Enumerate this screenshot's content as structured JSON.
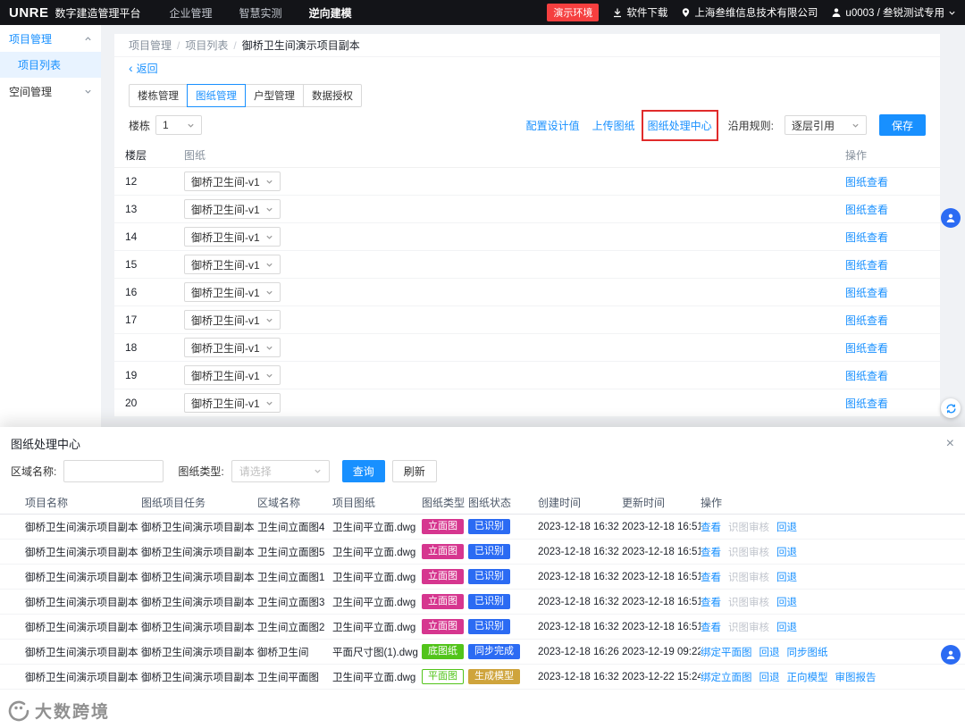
{
  "navbar": {
    "logo": "UNRE",
    "title": "数字建造管理平台",
    "menu": [
      {
        "label": "企业管理",
        "active": false
      },
      {
        "label": "智慧实测",
        "active": false
      },
      {
        "label": "逆向建模",
        "active": true
      }
    ],
    "env_badge": "演示环境",
    "download_label": "软件下载",
    "company": "上海叁维信息技术有限公司",
    "user": "u0003 / 叁锐测试专用"
  },
  "sidebar": {
    "group1": "项目管理",
    "item_selected": "项目列表",
    "group2": "空间管理"
  },
  "page": {
    "breadcrumb": [
      "项目管理",
      "项目列表",
      "御桥卫生间演示项目副本"
    ],
    "back": "返回"
  },
  "tabs": [
    {
      "label": "楼栋管理",
      "active": false
    },
    {
      "label": "图纸管理",
      "active": true
    },
    {
      "label": "户型管理",
      "active": false
    },
    {
      "label": "数据授权",
      "active": false
    }
  ],
  "toolbar": {
    "building_label": "楼栋",
    "building_value": "1",
    "link_config": "配置设计值",
    "link_upload": "上传图纸",
    "link_center": "图纸处理中心",
    "rule_label": "沿用规则:",
    "rule_value": "逐层引用",
    "save": "保存"
  },
  "floors_table": {
    "columns": [
      "楼层",
      "图纸",
      "操作"
    ],
    "drawing_value": "御桥卫生间-v1",
    "action": "图纸查看",
    "floors": [
      "12",
      "13",
      "14",
      "15",
      "16",
      "17",
      "18",
      "19",
      "20"
    ]
  },
  "drawer": {
    "title": "图纸处理中心",
    "close": "×",
    "filters": {
      "region_label": "区域名称:",
      "type_label": "图纸类型:",
      "type_placeholder": "请选择",
      "query": "查询",
      "refresh": "刷新"
    },
    "columns": [
      "项目名称",
      "图纸项目任务",
      "区域名称",
      "项目图纸",
      "图纸类型",
      "图纸状态",
      "创建时间",
      "更新时间",
      "操作"
    ],
    "rows": [
      {
        "project": "御桥卫生间演示项目副本",
        "task": "御桥卫生间演示项目副本",
        "region": "卫生间立面图4",
        "drawing": "卫生间平立面.dwg",
        "type": {
          "label": "立面图",
          "color": "#d6368f",
          "variant": "solid"
        },
        "status": {
          "label": "已识别",
          "color": "#2b6bf3",
          "variant": "solid"
        },
        "created": "2023-12-18 16:32",
        "updated": "2023-12-18 16:51",
        "actions": [
          {
            "label": "查看",
            "disabled": false
          },
          {
            "label": "识图审核",
            "disabled": true
          },
          {
            "label": "回退",
            "disabled": false
          }
        ]
      },
      {
        "project": "御桥卫生间演示项目副本",
        "task": "御桥卫生间演示项目副本",
        "region": "卫生间立面图5",
        "drawing": "卫生间平立面.dwg",
        "type": {
          "label": "立面图",
          "color": "#d6368f",
          "variant": "solid"
        },
        "status": {
          "label": "已识别",
          "color": "#2b6bf3",
          "variant": "solid"
        },
        "created": "2023-12-18 16:32",
        "updated": "2023-12-18 16:51",
        "actions": [
          {
            "label": "查看",
            "disabled": false
          },
          {
            "label": "识图审核",
            "disabled": true
          },
          {
            "label": "回退",
            "disabled": false
          }
        ]
      },
      {
        "project": "御桥卫生间演示项目副本",
        "task": "御桥卫生间演示项目副本",
        "region": "卫生间立面图1",
        "drawing": "卫生间平立面.dwg",
        "type": {
          "label": "立面图",
          "color": "#d6368f",
          "variant": "solid"
        },
        "status": {
          "label": "已识别",
          "color": "#2b6bf3",
          "variant": "solid"
        },
        "created": "2023-12-18 16:32",
        "updated": "2023-12-18 16:51",
        "actions": [
          {
            "label": "查看",
            "disabled": false
          },
          {
            "label": "识图审核",
            "disabled": true
          },
          {
            "label": "回退",
            "disabled": false
          }
        ]
      },
      {
        "project": "御桥卫生间演示项目副本",
        "task": "御桥卫生间演示项目副本",
        "region": "卫生间立面图3",
        "drawing": "卫生间平立面.dwg",
        "type": {
          "label": "立面图",
          "color": "#d6368f",
          "variant": "solid"
        },
        "status": {
          "label": "已识别",
          "color": "#2b6bf3",
          "variant": "solid"
        },
        "created": "2023-12-18 16:32",
        "updated": "2023-12-18 16:51",
        "actions": [
          {
            "label": "查看",
            "disabled": false
          },
          {
            "label": "识图审核",
            "disabled": true
          },
          {
            "label": "回退",
            "disabled": false
          }
        ]
      },
      {
        "project": "御桥卫生间演示项目副本",
        "task": "御桥卫生间演示项目副本",
        "region": "卫生间立面图2",
        "drawing": "卫生间平立面.dwg",
        "type": {
          "label": "立面图",
          "color": "#d6368f",
          "variant": "solid"
        },
        "status": {
          "label": "已识别",
          "color": "#2b6bf3",
          "variant": "solid"
        },
        "created": "2023-12-18 16:32",
        "updated": "2023-12-18 16:51",
        "actions": [
          {
            "label": "查看",
            "disabled": false
          },
          {
            "label": "识图审核",
            "disabled": true
          },
          {
            "label": "回退",
            "disabled": false
          }
        ]
      },
      {
        "project": "御桥卫生间演示项目副本",
        "task": "御桥卫生间演示项目副本",
        "region": "御桥卫生间",
        "drawing": "平面尺寸图(1).dwg",
        "type": {
          "label": "底图纸",
          "color": "#52c41a",
          "variant": "solid"
        },
        "status": {
          "label": "同步完成",
          "color": "#2b6bf3",
          "variant": "solid"
        },
        "created": "2023-12-18 16:26",
        "updated": "2023-12-19 09:22",
        "actions": [
          {
            "label": "绑定平面图",
            "disabled": false
          },
          {
            "label": "回退",
            "disabled": false
          },
          {
            "label": "同步图纸",
            "disabled": false
          }
        ]
      },
      {
        "project": "御桥卫生间演示项目副本",
        "task": "御桥卫生间演示项目副本",
        "region": "卫生间平面图",
        "drawing": "卫生间平立面.dwg",
        "type": {
          "label": "平面图",
          "color": "#52c41a",
          "variant": "outline"
        },
        "status": {
          "label": "生成模型",
          "color": "#cfa43c",
          "variant": "solid"
        },
        "created": "2023-12-18 16:32",
        "updated": "2023-12-22 15:24",
        "actions": [
          {
            "label": "绑定立面图",
            "disabled": false
          },
          {
            "label": "回退",
            "disabled": false
          },
          {
            "label": "正向模型",
            "disabled": false
          },
          {
            "label": "审图报告",
            "disabled": false
          }
        ]
      }
    ]
  },
  "floating": {
    "watermark": "大数跨境"
  },
  "colors": {
    "accent": "#1890ff",
    "env_badge_bg": "#f53f3f"
  }
}
